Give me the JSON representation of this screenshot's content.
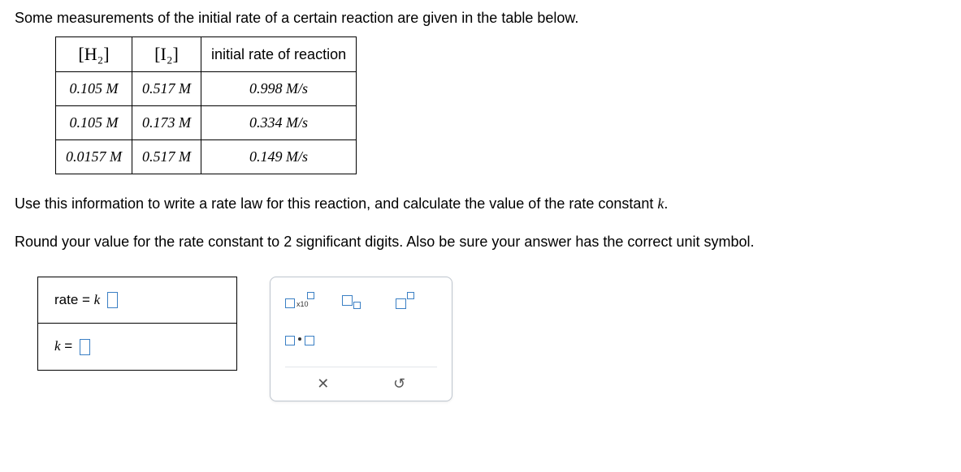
{
  "intro": "Some measurements of the initial rate of a certain reaction are given in the table below.",
  "table": {
    "headers": {
      "h2": "[H₂]",
      "i2": "[I₂]",
      "rate": "initial rate of reaction"
    },
    "rows": [
      {
        "h2": "0.105 M",
        "i2": "0.517 M",
        "rate": "0.998 M/s"
      },
      {
        "h2": "0.105 M",
        "i2": "0.173 M",
        "rate": "0.334 M/s"
      },
      {
        "h2": "0.0157 M",
        "i2": "0.517 M",
        "rate": "0.149 M/s"
      }
    ]
  },
  "instr1_a": "Use this information to write a rate law for this reaction, and calculate the value of the rate constant ",
  "instr1_k": "k",
  "instr1_b": ".",
  "instr2_a": "Round your value for the rate constant to ",
  "instr2_num": "2",
  "instr2_b": " significant digits. Also be sure your answer has the correct unit symbol.",
  "answers": {
    "rate_label_a": "rate = ",
    "rate_label_k": "k",
    "k_label": "k",
    "k_eq": " = "
  },
  "palette": {
    "sci_text": "x10",
    "clear": "✕",
    "undo": "↻"
  }
}
